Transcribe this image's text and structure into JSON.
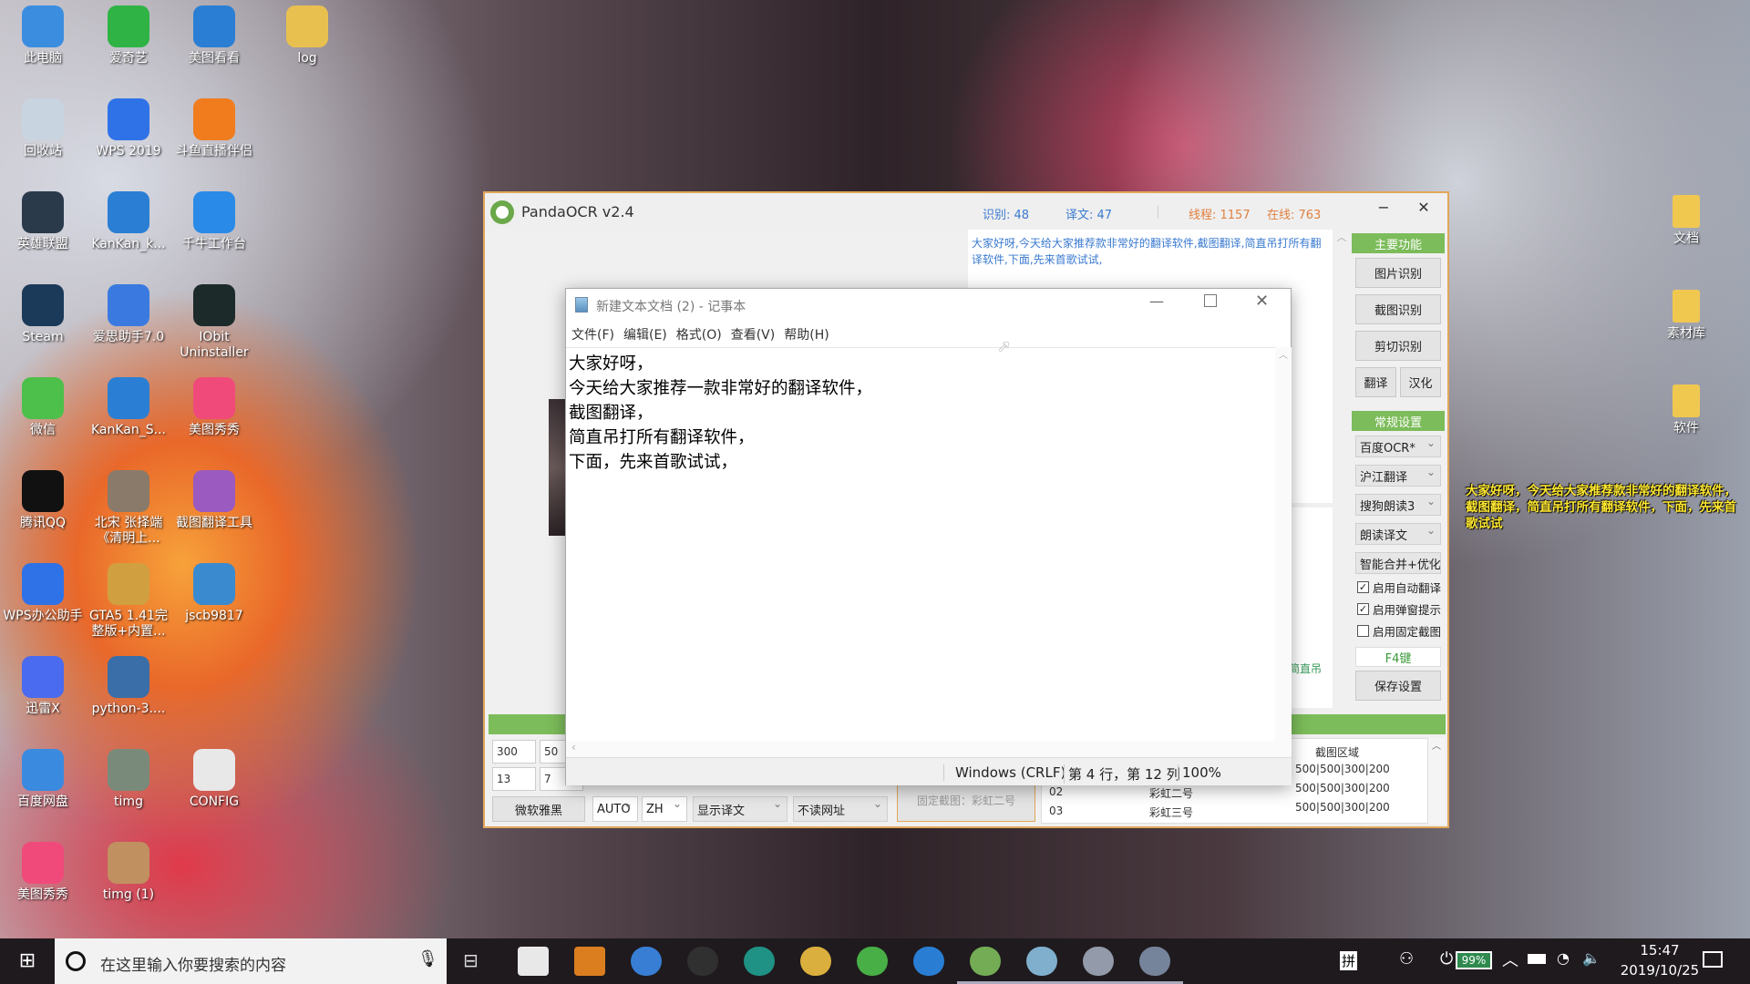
{
  "desktop": {
    "left_icons": [
      {
        "label": "此电脑",
        "color": "#3b8de0"
      },
      {
        "label": "爱奇艺",
        "color": "#2fb344"
      },
      {
        "label": "美图看看",
        "color": "#2a7fd4"
      },
      {
        "label": "log",
        "color": "#e8c050"
      },
      {
        "label": "回收站",
        "color": "#c8d4e0"
      },
      {
        "label": "WPS 2019",
        "color": "#2f72e8"
      },
      {
        "label": "斗鱼直播伴侣",
        "color": "#f07c1e"
      },
      {
        "label": "英雄联盟",
        "color": "#2a3a4a"
      },
      {
        "label": "KanKan_k...",
        "color": "#2a7fd4"
      },
      {
        "label": "千牛工作台",
        "color": "#2a8ae8"
      },
      {
        "label": "Steam",
        "color": "#1b3a5a"
      },
      {
        "label": "爱思助手7.0",
        "color": "#3a7ae0"
      },
      {
        "label": "IObit Uninstaller",
        "color": "#1c2a2a"
      },
      {
        "label": "微信",
        "color": "#4cc04a"
      },
      {
        "label": "KanKan_S...",
        "color": "#2a7fd4"
      },
      {
        "label": "美图秀秀",
        "color": "#f04a7a"
      },
      {
        "label": "腾讯QQ",
        "color": "#111"
      },
      {
        "label": "北宋 张择端《清明上...",
        "color": "#8a7a6a"
      },
      {
        "label": "截图翻译工具",
        "color": "#9a5ac0"
      },
      {
        "label": "WPS办公助手",
        "color": "#2f72e8"
      },
      {
        "label": "GTA5 1.41完整版+内置...",
        "color": "#d0a040"
      },
      {
        "label": "jscb9817",
        "color": "#3a8ad0"
      },
      {
        "label": "迅雷X",
        "color": "#4a6af0"
      },
      {
        "label": "python-3....",
        "color": "#3a6ea8"
      },
      {
        "label": "百度网盘",
        "color": "#3a8ae0"
      },
      {
        "label": "timg",
        "color": "#7a8a7a"
      },
      {
        "label": "CONFIG",
        "color": "#e8e8e8"
      },
      {
        "label": "美图秀秀",
        "color": "#f04a7a"
      },
      {
        "label": "timg (1)",
        "color": "#c09060"
      }
    ],
    "right_icons": [
      {
        "label": "文档"
      },
      {
        "label": "素材库"
      },
      {
        "label": "软件"
      }
    ],
    "subtitle": "大家好呀，今天给大家推荐款非常好的翻译软件，截图翻译，简直吊打所有翻译软件，下面，先来首歌试试"
  },
  "panda": {
    "title": "PandaOCR v2.4",
    "stats": {
      "ocr_label": "识别: 48",
      "trans_label": "译文: 47",
      "thread_label": "线程: 1157",
      "online_label": "在线: 763"
    },
    "result_text": "大家好呀,今天给大家推荐款非常好的翻译软件,截图翻译,简直吊打所有翻译软件,下面,先来首歌试试,",
    "lower_text_partial": "简直吊",
    "main_header": "主要功能",
    "buttons": {
      "image_ocr": "图片识别",
      "screenshot_ocr": "截图识别",
      "clipboard_ocr": "剪切识别",
      "translate": "翻译",
      "localize": "汉化"
    },
    "settings_header": "常规设置",
    "dropdowns": [
      "百度OCR*",
      "沪江翻译",
      "搜狗朗读3",
      "朗读译文",
      "智能合并+优化"
    ],
    "checkboxes": [
      {
        "label": "启用自动翻译",
        "checked": true
      },
      {
        "label": "启用弹窗提示",
        "checked": true
      },
      {
        "label": "启用固定截图",
        "checked": false
      }
    ],
    "hotkey": "F4键",
    "save": "保存设置",
    "bottom": {
      "field1": "300",
      "field2": "50",
      "field3": "13",
      "field4": "7",
      "font": "微软雅黑",
      "lang_from": "AUTO",
      "lang_to": "ZH",
      "display": "显示译文",
      "read_url": "不读网址",
      "fixed_shot": "固定截图：彩虹二号",
      "table_header": "截图区域",
      "rows": [
        {
          "id": "",
          "name": "",
          "area": "500|500|300|200"
        },
        {
          "id": "02",
          "name": "彩虹二号",
          "area": "500|500|300|200"
        },
        {
          "id": "03",
          "name": "彩虹三号",
          "area": "500|500|300|200"
        }
      ]
    }
  },
  "notepad": {
    "title": "新建文本文档 (2) - 记事本",
    "menu": [
      "文件(F)",
      "编辑(E)",
      "格式(O)",
      "查看(V)",
      "帮助(H)"
    ],
    "lines": [
      "大家好呀，",
      "今天给大家推荐一款非常好的翻译软件，",
      "截图翻译，",
      "简直吊打所有翻译软件，",
      "下面，先来首歌试试，"
    ],
    "status": {
      "eol": "Windows (CRLF)",
      "position": "第 4 行，第 12 列",
      "zoom": "100%"
    }
  },
  "taskbar": {
    "search_placeholder": "在这里输入你要搜索的内容",
    "apps": [
      {
        "icon": "cortana-mic-icon",
        "color": "#fff"
      },
      {
        "icon": "search-tool-icon",
        "color": "#f08a20"
      },
      {
        "icon": "l-app-icon",
        "color": "#3a8ae8"
      },
      {
        "icon": "l-box-icon",
        "color": "#333"
      },
      {
        "icon": "iobit-icon",
        "color": "#1fa090"
      },
      {
        "icon": "file-explorer-icon",
        "color": "#f0c040"
      },
      {
        "icon": "wechat-icon",
        "color": "#4cc04a"
      },
      {
        "icon": "sogou-icon",
        "color": "#2a8ae8"
      },
      {
        "icon": "panda-icon",
        "color": "#7cbc5a"
      },
      {
        "icon": "notepad-icon",
        "color": "#8ac0e0"
      },
      {
        "icon": "app-icon",
        "color": "#a0a8b8"
      },
      {
        "icon": "app2-icon",
        "color": "#8090a8"
      }
    ],
    "ime": "拼",
    "battery": "99%",
    "time": "15:47",
    "date": "2019/10/25"
  }
}
